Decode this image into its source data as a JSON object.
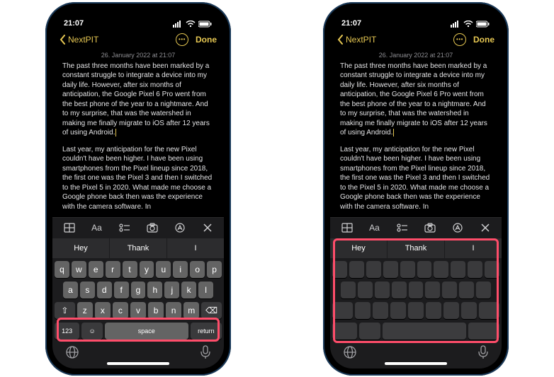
{
  "status": {
    "time": "21:07"
  },
  "nav": {
    "back_label": "NextPIT",
    "done_label": "Done"
  },
  "note": {
    "date_line": "26. January 2022 at 21:07",
    "p1": "The past three months have been marked by a constant struggle to integrate a device into my daily life. However, after six months of anticipation, the Google Pixel 6 Pro went from the best phone of the year to a nightmare. And to my surprise, that was the watershed in making me finally migrate to iOS after 12 years of using Android.",
    "p2": "Last year, my anticipation for the new Pixel couldn't have been higher. I have been using smartphones from the Pixel lineup since 2018, the first one was the Pixel 3 and then I switched to the Pixel 5 in 2020. What made me choose a Google phone back then was the experience with the camera software. In"
  },
  "toolbar": {
    "table_icon": "table-icon",
    "format_label": "Aa",
    "checklist_icon": "checklist-icon",
    "camera_icon": "camera-icon",
    "markup_icon": "markup-icon",
    "close_icon": "close-icon"
  },
  "suggestions": [
    "Hey",
    "Thank",
    "I"
  ],
  "keyboard": {
    "row1": [
      "q",
      "w",
      "e",
      "r",
      "t",
      "y",
      "u",
      "i",
      "o",
      "p"
    ],
    "row2": [
      "a",
      "s",
      "d",
      "f",
      "g",
      "h",
      "j",
      "k",
      "l"
    ],
    "row3_shift": "⇧",
    "row3": [
      "z",
      "x",
      "c",
      "v",
      "b",
      "n",
      "m"
    ],
    "row3_del": "⌫",
    "num_label": "123",
    "space_label": "space",
    "return_label": "return",
    "emoji": "☺"
  },
  "dock": {
    "globe_icon": "globe-icon",
    "mic_icon": "mic-icon"
  }
}
